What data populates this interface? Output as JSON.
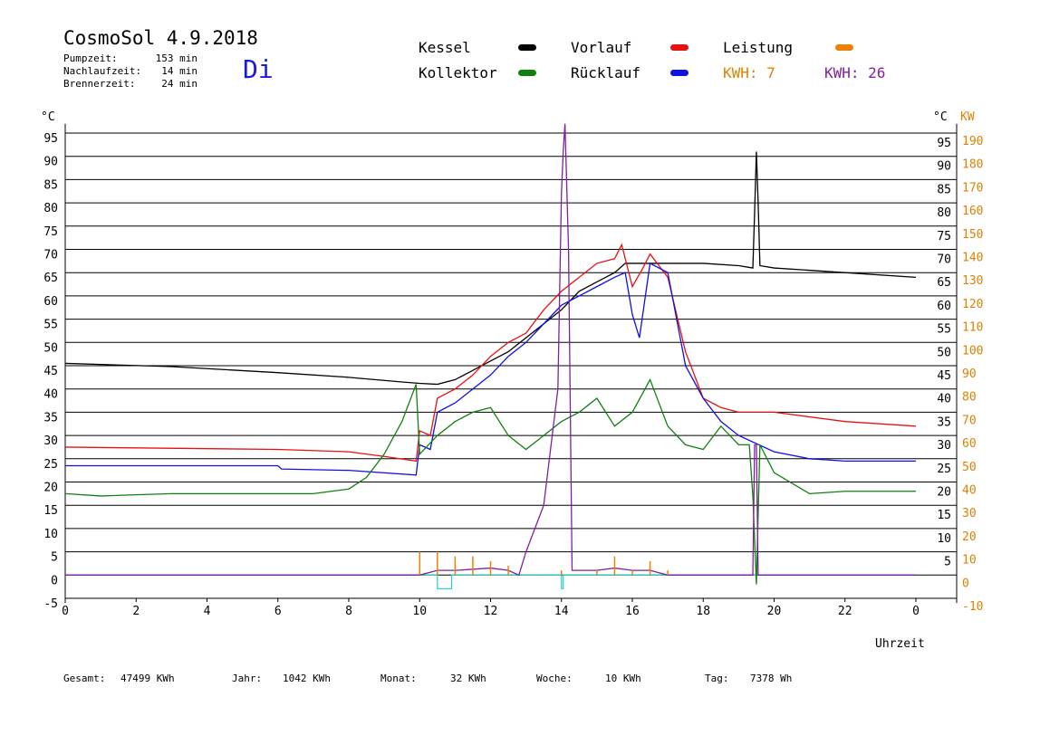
{
  "header": {
    "title": "CosmoSol 4.9.2018",
    "day": "Di",
    "info": [
      {
        "label": "Pumpzeit:",
        "value": "153 min"
      },
      {
        "label": "Nachlaufzeit:",
        "value": "14 min"
      },
      {
        "label": "Brennerzeit:",
        "value": "24 min"
      }
    ]
  },
  "legend": {
    "kessel": {
      "label": "Kessel",
      "color": "#000000"
    },
    "vorlauf": {
      "label": "Vorlauf",
      "color": "#e81010"
    },
    "leistung": {
      "label": "Leistung",
      "color": "#f08000"
    },
    "kollektor": {
      "label": "Kollektor",
      "color": "#108010"
    },
    "ruecklauf": {
      "label": "Rücklauf",
      "color": "#1010e0"
    },
    "kwh_orange": "KWH: 7",
    "kwh_purple": "KWH: 26",
    "kwh_orange_color": "#e08000",
    "kwh_purple_color": "#8020a0"
  },
  "chart_data": {
    "type": "line",
    "y_left_label": "°C",
    "y_right_label": "°C",
    "y_right2_label": "KW",
    "x_label": "Uhrzeit",
    "x_ticks": [
      "0",
      "2",
      "4",
      "6",
      "8",
      "10",
      "12",
      "14",
      "16",
      "18",
      "20",
      "22",
      "0"
    ],
    "y_left_ticks": [
      "95",
      "90",
      "85",
      "80",
      "75",
      "70",
      "65",
      "60",
      "55",
      "50",
      "45",
      "40",
      "35",
      "30",
      "25",
      "20",
      "15",
      "10",
      "5",
      "0",
      "-5"
    ],
    "y_right_ticks": [
      "95",
      "90",
      "85",
      "80",
      "75",
      "70",
      "65",
      "60",
      "55",
      "50",
      "45",
      "40",
      "35",
      "30",
      "25",
      "20",
      "15",
      "10",
      "5"
    ],
    "y_kw_ticks": [
      "190",
      "180",
      "170",
      "160",
      "150",
      "140",
      "130",
      "120",
      "110",
      "100",
      "90",
      "80",
      "70",
      "60",
      "50",
      "40",
      "30",
      "20",
      "10",
      "0",
      "-10"
    ],
    "xlim": [
      0,
      24
    ],
    "ylim": [
      -5,
      97
    ],
    "grid": true,
    "series": [
      {
        "name": "Kessel",
        "color": "#000000",
        "x": [
          0,
          3,
          6,
          8,
          9.5,
          10,
          10.5,
          11,
          11.5,
          12,
          12.5,
          13,
          13.5,
          14,
          14.5,
          15,
          15.5,
          15.8,
          16,
          17,
          18,
          19,
          19.4,
          19.45,
          19.5,
          19.55,
          19.6,
          20,
          22,
          24
        ],
        "y": [
          45.5,
          44.8,
          43.5,
          42.5,
          41.5,
          41.2,
          41,
          42,
          44,
          46,
          48,
          51,
          54,
          57,
          61,
          63,
          65,
          67,
          67,
          67,
          67,
          66.5,
          66,
          78,
          91,
          80,
          66.5,
          66,
          65,
          64
        ]
      },
      {
        "name": "Vorlauf",
        "color": "#e81010",
        "x": [
          0,
          6,
          8,
          9,
          9.9,
          10,
          10.3,
          10.5,
          11,
          11.5,
          12,
          12.5,
          13,
          13.5,
          14,
          14.5,
          15,
          15.5,
          15.7,
          16,
          16.3,
          16.5,
          17,
          17.5,
          18,
          18.5,
          19,
          20,
          22,
          24
        ],
        "y": [
          27.5,
          27,
          26.5,
          25.5,
          24.5,
          31,
          30,
          38,
          40,
          43,
          47,
          50,
          52,
          57,
          61,
          64,
          67,
          68,
          71,
          62,
          66,
          69,
          64,
          48,
          38,
          36,
          35,
          35,
          33,
          32
        ]
      },
      {
        "name": "Rücklauf",
        "color": "#1010e0",
        "x": [
          0,
          6,
          6.1,
          8,
          9.9,
          10,
          10.3,
          10.5,
          11,
          11.5,
          12,
          12.5,
          13,
          13.5,
          14,
          14.5,
          15,
          15.5,
          15.8,
          16,
          16.2,
          16.5,
          17,
          17.5,
          18,
          18.5,
          19,
          20,
          21,
          22,
          24
        ],
        "y": [
          23.5,
          23.5,
          22.8,
          22.5,
          21.5,
          28,
          27,
          35,
          37,
          40,
          43,
          47,
          50,
          54,
          58,
          60,
          62,
          64,
          65,
          56,
          51,
          67,
          65,
          45,
          38,
          33,
          30,
          26.5,
          25,
          24.5,
          24.5
        ]
      },
      {
        "name": "Kollektor",
        "color": "#108010",
        "x": [
          0,
          1,
          3,
          5,
          7,
          8,
          8.5,
          9,
          9.5,
          9.9,
          10,
          10.5,
          11,
          11.5,
          12,
          12.5,
          13,
          13.5,
          14,
          14.5,
          15,
          15.5,
          16,
          16.5,
          17,
          17.5,
          18,
          18.5,
          19,
          19.3,
          19.4,
          19.5,
          19.6,
          20,
          21,
          22,
          24
        ],
        "y": [
          17.5,
          17,
          17.5,
          17.5,
          17.5,
          18.5,
          21,
          26,
          33,
          41,
          26,
          30,
          33,
          35,
          36,
          30,
          27,
          30,
          33,
          35,
          38,
          32,
          35,
          42,
          32,
          28,
          27,
          32,
          28,
          28,
          17,
          -2,
          28,
          22,
          17.5,
          18,
          18
        ]
      },
      {
        "name": "Leistung",
        "color": "#8020a0",
        "x": [
          0,
          9.9,
          10,
          10.5,
          11,
          12,
          12.5,
          12.8,
          13,
          13.5,
          13.9,
          14,
          14.05,
          14.1,
          14.2,
          14.3,
          14.4,
          15,
          15.5,
          16,
          16.5,
          17,
          17.5,
          19.4,
          19.45,
          19.5,
          19.55,
          24
        ],
        "y": [
          0,
          0,
          0,
          1,
          1,
          1.5,
          1,
          0,
          5,
          15,
          40,
          82,
          91,
          97,
          70,
          1,
          1,
          1,
          1.5,
          1,
          1,
          0,
          0,
          0,
          28,
          28,
          0,
          0
        ]
      }
    ],
    "kw_marker_series": {
      "name": "Leistung-KW",
      "color": "#f08000",
      "x": [
        10,
        10.5,
        11,
        11.5,
        12,
        12.5,
        14,
        15,
        15.5,
        16,
        16.5,
        17
      ],
      "y": [
        5,
        5,
        4,
        4,
        3,
        2,
        1,
        1,
        4,
        1,
        3,
        1
      ]
    },
    "baseline": {
      "color": "#20d0d0",
      "y": 0,
      "dips": [
        [
          10.5,
          10.9
        ],
        [
          14.0,
          14.05
        ]
      ]
    }
  },
  "axis": {
    "uhrzeit": "Uhrzeit"
  },
  "footer": [
    {
      "label": "Gesamt:",
      "value": "47499 KWh"
    },
    {
      "label": "Jahr:",
      "value": "1042 KWh"
    },
    {
      "label": "Monat:",
      "value": "32 KWh"
    },
    {
      "label": "Woche:",
      "value": "10 KWh"
    },
    {
      "label": "Tag:",
      "value": "7378 Wh"
    }
  ]
}
